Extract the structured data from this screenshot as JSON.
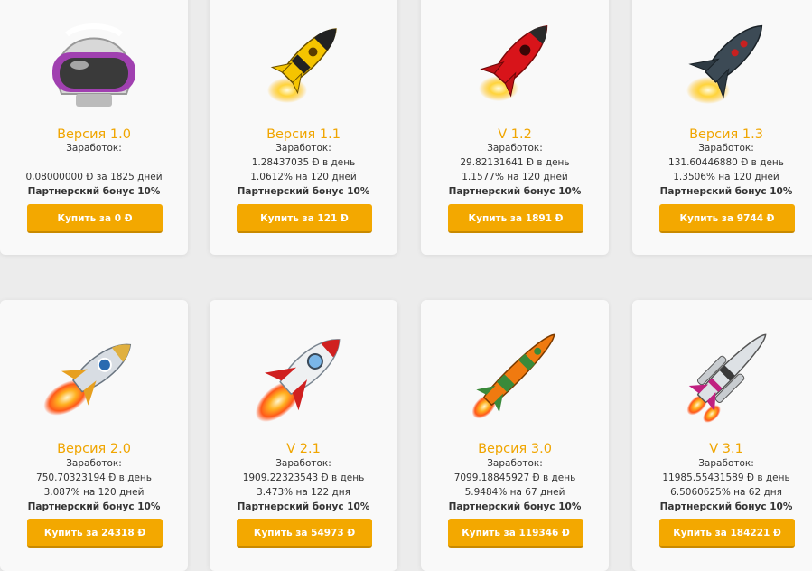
{
  "rows": [
    [
      {
        "title": "Версия 1.0",
        "earn_label": "Заработок:",
        "line1": "",
        "line2": "0,08000000 Ð за 1825 дней",
        "bonus": "Партнерский бонус 10%",
        "button": "Купить за 0 Ð",
        "icon": "helmet-icon"
      },
      {
        "title": "Версия 1.1",
        "earn_label": "Заработок:",
        "line1": "1.28437035 Ð в день",
        "line2": "1.0612% на 120 дней",
        "bonus": "Партнерский бонус 10%",
        "button": "Купить за 121 Ð",
        "icon": "yellow-rocket-icon"
      },
      {
        "title": "V 1.2",
        "earn_label": "Заработок:",
        "line1": "29.82131641 Ð в день",
        "line2": "1.1577% на 120 дней",
        "bonus": "Партнерский бонус 10%",
        "button": "Купить за 1891 Ð",
        "icon": "red-rocket-icon"
      },
      {
        "title": "Версия 1.3",
        "earn_label": "Заработок:",
        "line1": "131.60446880 Ð в день",
        "line2": "1.3506% на 120 дней",
        "bonus": "Партнерский бонус 10%",
        "button": "Купить за 9744 Ð",
        "icon": "dark-rocket-icon"
      }
    ],
    [
      {
        "title": "Версия 2.0",
        "earn_label": "Заработок:",
        "line1": "750.70323194 Ð в день",
        "line2": "3.087% на 120 дней",
        "bonus": "Партнерский бонус 10%",
        "button": "Купить за 24318 Ð",
        "icon": "silver-rocket-icon"
      },
      {
        "title": "V 2.1",
        "earn_label": "Заработок:",
        "line1": "1909.22323543 Ð в день",
        "line2": "3.473% на 122 дня",
        "bonus": "Партнерский бонус 10%",
        "button": "Купить за 54973 Ð",
        "icon": "white-red-rocket-icon"
      },
      {
        "title": "Версия 3.0",
        "earn_label": "Заработок:",
        "line1": "7099.18845927 Ð в день",
        "line2": "5.9484% на 67 дней",
        "bonus": "Партнерский бонус 10%",
        "button": "Купить за 119346 Ð",
        "icon": "orange-missile-icon"
      },
      {
        "title": "V 3.1",
        "earn_label": "Заработок:",
        "line1": "11985.55431589 Ð в день",
        "line2": "6.5060625% на 62 дня",
        "bonus": "Партнерский бонус 10%",
        "button": "Купить за 184221 Ð",
        "icon": "shuttle-rocket-icon"
      }
    ]
  ],
  "colors": {
    "accent": "#f3a800",
    "title": "#f0a500",
    "card": "#f9f9f9",
    "background": "#ececec"
  }
}
